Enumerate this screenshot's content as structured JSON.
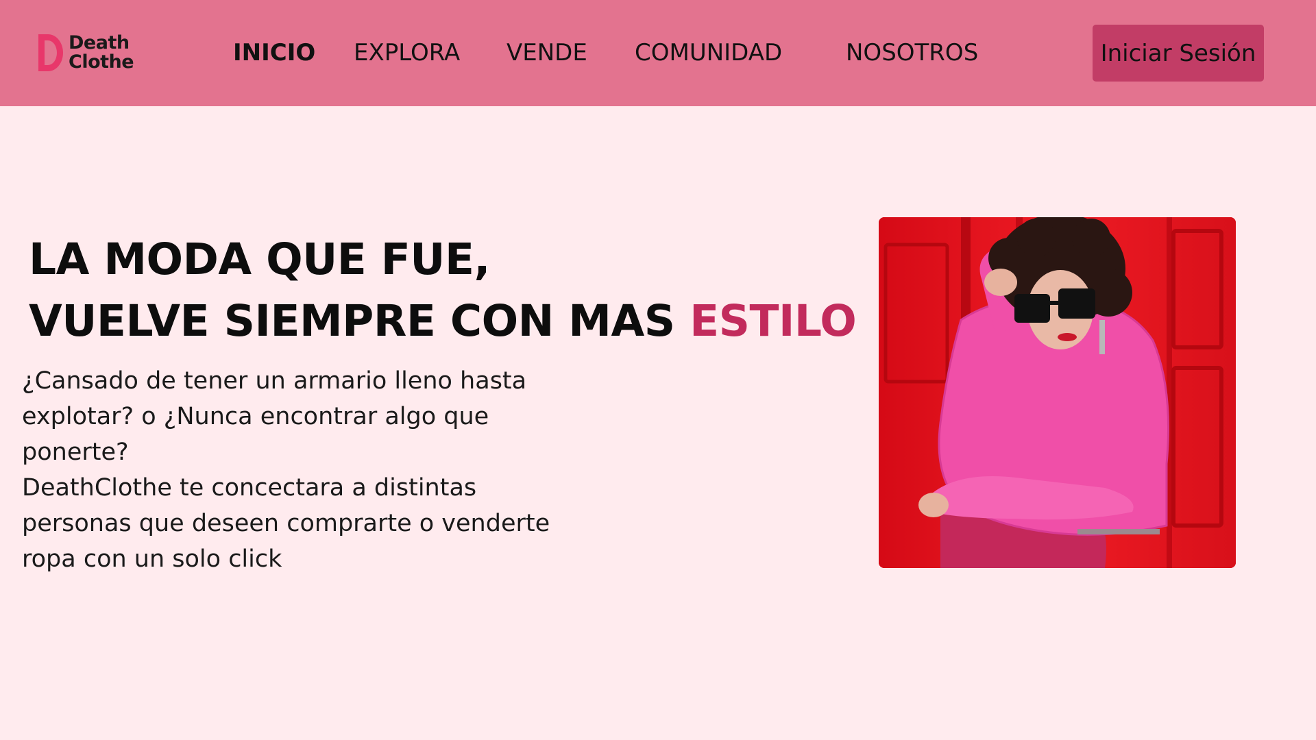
{
  "brand": {
    "line1": "Death",
    "line2": "Clothe",
    "logo_letter": "D",
    "accent_color": "#E8376A"
  },
  "nav": {
    "items": [
      {
        "label": "INICIO",
        "active": true
      },
      {
        "label": "EXPLORA",
        "active": false
      },
      {
        "label": "VENDE",
        "active": false
      },
      {
        "label": "COMUNIDAD",
        "active": false
      },
      {
        "label": "NOSOTROS",
        "active": false
      }
    ],
    "login_label": "Iniciar Sesión"
  },
  "hero": {
    "title_line1": "LA MODA QUE FUE,",
    "title_line2_prefix": "VUELVE SIEMPRE CON MAS",
    "title_line2_accent": "ESTILO",
    "paragraph1": "¿Cansado de tener un armario lleno hasta explotar? o ¿Nunca encontrar algo que ponerte?",
    "paragraph2": "DeathClothe te concectara a distintas personas que deseen comprarte o venderte ropa con un solo click"
  },
  "colors": {
    "navbar_bg": "#E3738F",
    "page_bg": "#FFEBEE",
    "button_bg": "#C23D66",
    "title_accent": "#C22B5C"
  }
}
